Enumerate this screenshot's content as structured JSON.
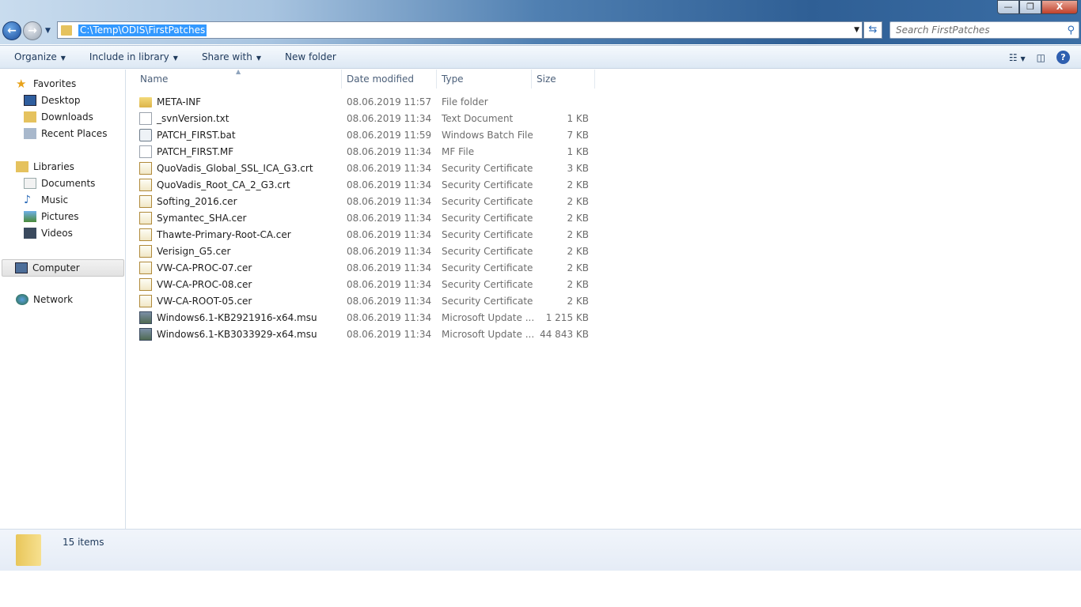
{
  "window": {
    "minimize": "—",
    "maximize": "❐",
    "close": "X"
  },
  "address": {
    "path": "C:\\Temp\\ODIS\\FirstPatches"
  },
  "search": {
    "placeholder": "Search FirstPatches"
  },
  "toolbar": {
    "organize": "Organize",
    "include": "Include in library",
    "share": "Share with",
    "new_folder": "New folder"
  },
  "sidebar": {
    "favorites": "Favorites",
    "desktop": "Desktop",
    "downloads": "Downloads",
    "recent": "Recent Places",
    "libraries": "Libraries",
    "documents": "Documents",
    "music": "Music",
    "pictures": "Pictures",
    "videos": "Videos",
    "computer": "Computer",
    "network": "Network"
  },
  "columns": {
    "name": "Name",
    "date": "Date modified",
    "type": "Type",
    "size": "Size"
  },
  "files": [
    {
      "name": "META-INF",
      "date": "08.06.2019 11:57",
      "type": "File folder",
      "size": "",
      "icon": "folder"
    },
    {
      "name": "_svnVersion.txt",
      "date": "08.06.2019 11:34",
      "type": "Text Document",
      "size": "1 KB",
      "icon": "text"
    },
    {
      "name": "PATCH_FIRST.bat",
      "date": "08.06.2019 11:59",
      "type": "Windows Batch File",
      "size": "7 KB",
      "icon": "batch"
    },
    {
      "name": "PATCH_FIRST.MF",
      "date": "08.06.2019 11:34",
      "type": "MF File",
      "size": "1 KB",
      "icon": "file"
    },
    {
      "name": "QuoVadis_Global_SSL_ICA_G3.crt",
      "date": "08.06.2019 11:34",
      "type": "Security Certificate",
      "size": "3 KB",
      "icon": "cert"
    },
    {
      "name": "QuoVadis_Root_CA_2_G3.crt",
      "date": "08.06.2019 11:34",
      "type": "Security Certificate",
      "size": "2 KB",
      "icon": "cert"
    },
    {
      "name": "Softing_2016.cer",
      "date": "08.06.2019 11:34",
      "type": "Security Certificate",
      "size": "2 KB",
      "icon": "cert"
    },
    {
      "name": "Symantec_SHA.cer",
      "date": "08.06.2019 11:34",
      "type": "Security Certificate",
      "size": "2 KB",
      "icon": "cert"
    },
    {
      "name": "Thawte-Primary-Root-CA.cer",
      "date": "08.06.2019 11:34",
      "type": "Security Certificate",
      "size": "2 KB",
      "icon": "cert"
    },
    {
      "name": "Verisign_G5.cer",
      "date": "08.06.2019 11:34",
      "type": "Security Certificate",
      "size": "2 KB",
      "icon": "cert"
    },
    {
      "name": "VW-CA-PROC-07.cer",
      "date": "08.06.2019 11:34",
      "type": "Security Certificate",
      "size": "2 KB",
      "icon": "cert"
    },
    {
      "name": "VW-CA-PROC-08.cer",
      "date": "08.06.2019 11:34",
      "type": "Security Certificate",
      "size": "2 KB",
      "icon": "cert"
    },
    {
      "name": "VW-CA-ROOT-05.cer",
      "date": "08.06.2019 11:34",
      "type": "Security Certificate",
      "size": "2 KB",
      "icon": "cert"
    },
    {
      "name": "Windows6.1-KB2921916-x64.msu",
      "date": "08.06.2019 11:34",
      "type": "Microsoft Update ...",
      "size": "1 215 KB",
      "icon": "msu"
    },
    {
      "name": "Windows6.1-KB3033929-x64.msu",
      "date": "08.06.2019 11:34",
      "type": "Microsoft Update ...",
      "size": "44 843 KB",
      "icon": "msu"
    }
  ],
  "status": {
    "count": "15 items"
  }
}
